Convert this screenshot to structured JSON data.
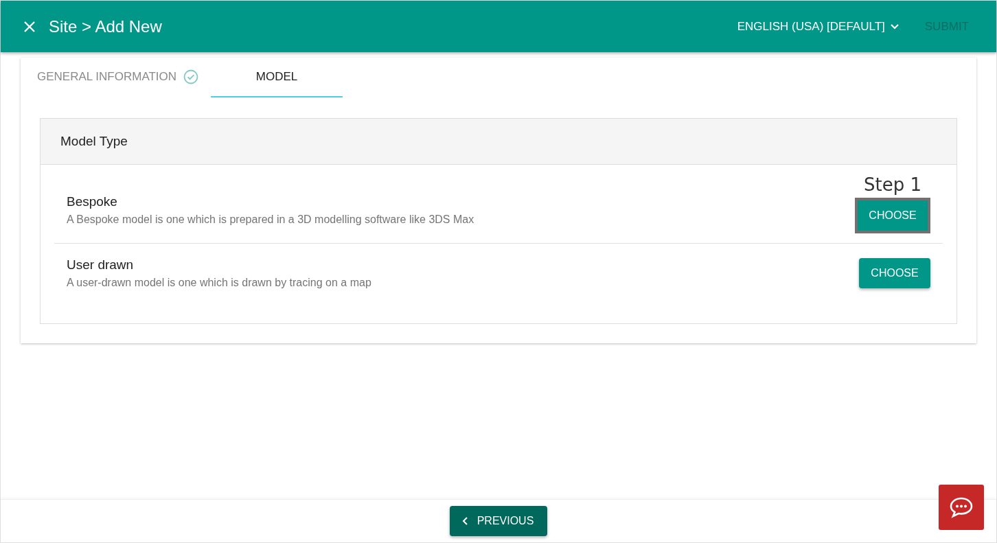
{
  "header": {
    "title": "Site > Add New",
    "language": "ENGLISH (USA) [DEFAULT]",
    "submit": {
      "label": "SUBMIT",
      "disabled": true
    }
  },
  "tabs": [
    {
      "label": "GENERAL INFORMATION",
      "completed": true,
      "selected": false
    },
    {
      "label": "MODEL",
      "completed": false,
      "selected": true
    }
  ],
  "panel": {
    "title": "Model Type",
    "options": [
      {
        "name": "Bespoke",
        "description": "A Bespoke model is one which is prepared in a 3D modelling software like 3DS Max",
        "button": "CHOOSE",
        "highlighted": true,
        "callout": "Step 1"
      },
      {
        "name": "User drawn",
        "description": "A user-drawn model is one which is drawn by tracing on a map",
        "button": "CHOOSE",
        "highlighted": false
      }
    ]
  },
  "footer": {
    "previous": "PREVIOUS"
  }
}
